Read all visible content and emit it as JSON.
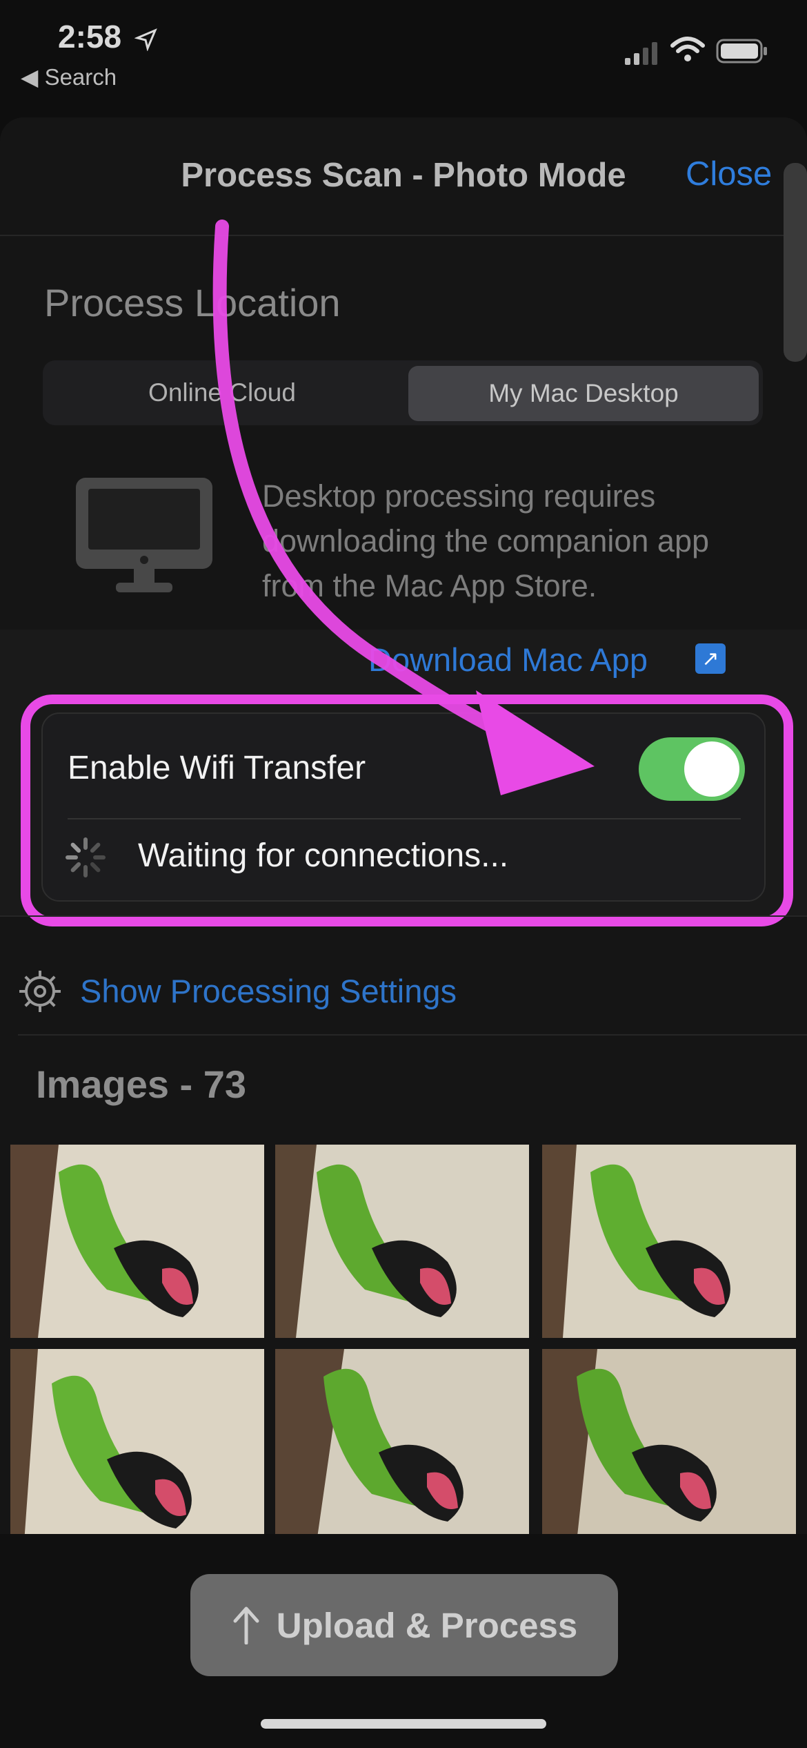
{
  "status_bar": {
    "time": "2:58",
    "back_label": "Search"
  },
  "sheet": {
    "title": "Process Scan - Photo Mode",
    "close_label": "Close"
  },
  "process_location": {
    "title": "Process Location",
    "options": [
      "Online Cloud",
      "My Mac Desktop"
    ],
    "selected": "My Mac Desktop",
    "description": "Desktop processing requires downloading the companion app from the Mac App Store.",
    "download_link": "Download Mac App"
  },
  "wifi": {
    "label": "Enable Wifi Transfer",
    "enabled": true,
    "status": "Waiting for connections..."
  },
  "settings": {
    "link": "Show Processing Settings"
  },
  "images": {
    "title": "Images - 73",
    "thumbnails": [
      "photo-1",
      "photo-2",
      "photo-3",
      "photo-4",
      "photo-5",
      "photo-6"
    ]
  },
  "upload": {
    "label": "Upload & Process"
  },
  "colors": {
    "accent": "#2e79d6",
    "toggle_on": "#5ec462",
    "annotation": "#e84ae6"
  }
}
